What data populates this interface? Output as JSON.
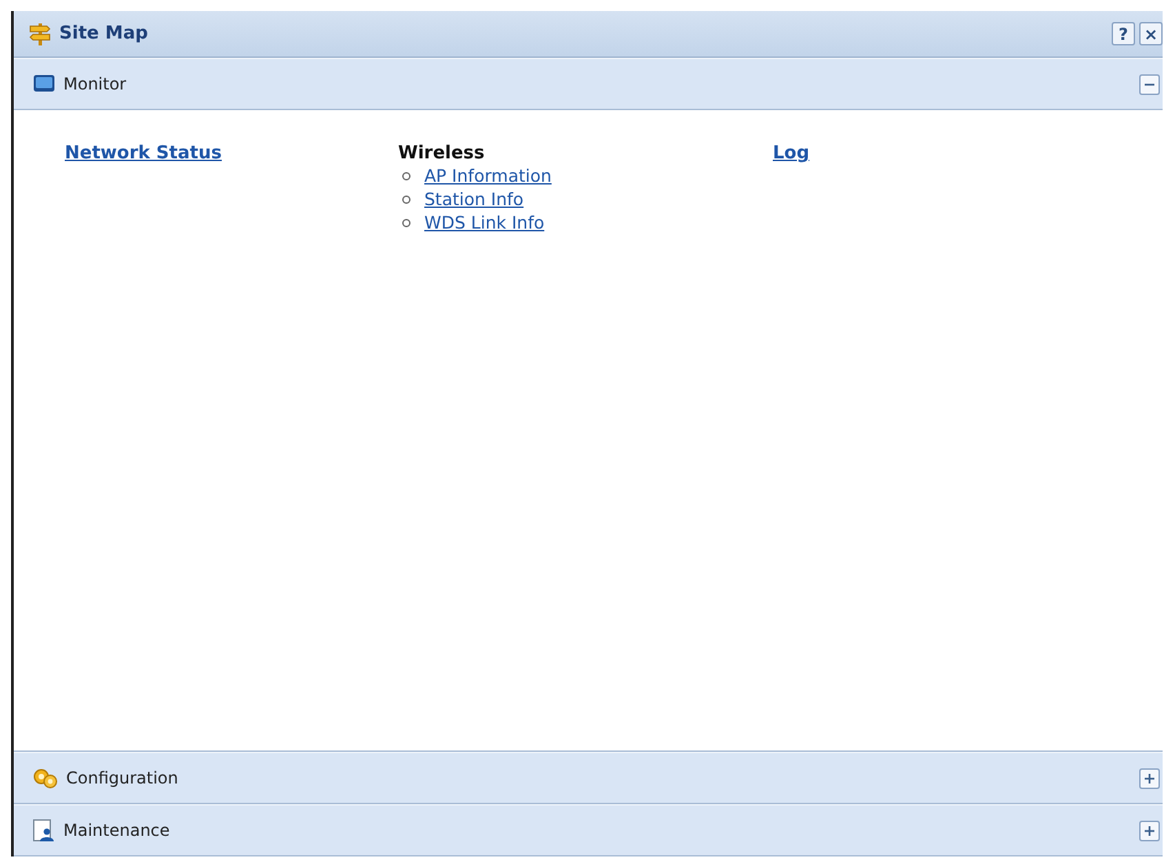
{
  "window": {
    "title": "Site Map",
    "help": "?",
    "close": "×"
  },
  "sections": [
    {
      "kind": "monitor",
      "label": "Monitor",
      "expanded": true,
      "columns": [
        {
          "kind": "link",
          "label": "Network Status"
        },
        {
          "kind": "group",
          "heading": "Wireless",
          "links": [
            "AP Information",
            "Station Info",
            "WDS Link Info"
          ]
        },
        {
          "kind": "link",
          "label": "Log"
        }
      ]
    },
    {
      "kind": "configuration",
      "label": "Configuration",
      "expanded": false
    },
    {
      "kind": "maintenance",
      "label": "Maintenance",
      "expanded": false
    }
  ]
}
